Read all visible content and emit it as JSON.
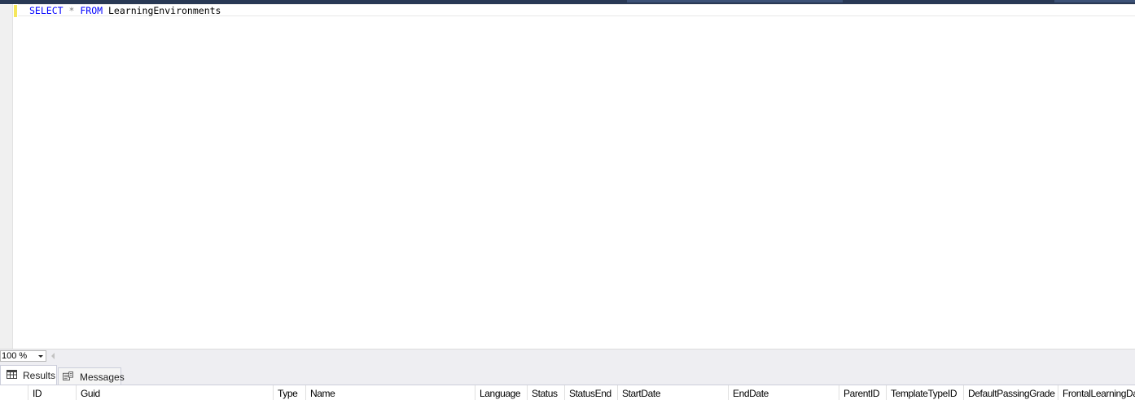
{
  "editor": {
    "query": {
      "kw_select": "SELECT",
      "star": "*",
      "kw_from": "FROM",
      "table": "LearningEnvironments"
    }
  },
  "zoom": {
    "value": "100 %"
  },
  "results_tabs": {
    "results_label": "Results",
    "messages_label": "Messages",
    "active": "results"
  },
  "grid": {
    "columns": [
      "ID",
      "Guid",
      "Type",
      "Name",
      "Language",
      "Status",
      "StatusEnd",
      "StartDate",
      "EndDate",
      "ParentID",
      "TemplateTypeID",
      "DefaultPassingGrade",
      "FrontalLearningDay"
    ]
  },
  "colors": {
    "keyword": "#0000ff",
    "operator": "#808080",
    "tabstrip": "#293955",
    "change_marker": "#f5e75c"
  }
}
